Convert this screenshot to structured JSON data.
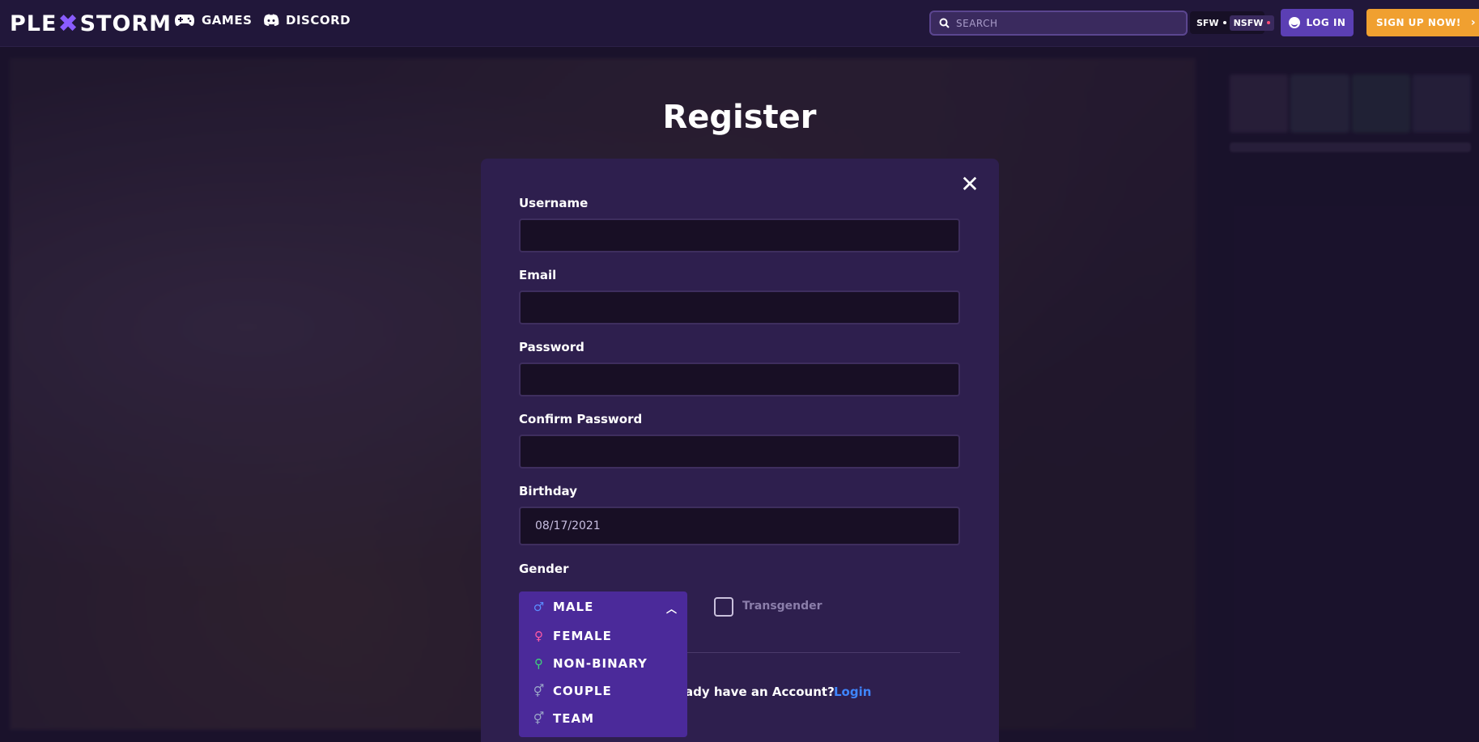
{
  "brand": {
    "logo_left": "PLE",
    "logo_x": "✖",
    "logo_right": "STORM"
  },
  "nav": {
    "games_label": "GAMES",
    "discord_label": "DISCORD"
  },
  "search": {
    "placeholder": "SEARCH"
  },
  "content_filter": {
    "sfw_label": "SFW",
    "nsfw_label": "NSFW"
  },
  "auth": {
    "login_label": "LOG IN",
    "signup_label": "SIGN UP NOW!"
  },
  "register": {
    "heading": "Register",
    "close_glyph": "✕",
    "fields": {
      "username_label": "Username",
      "username_value": "",
      "email_label": "Email",
      "email_value": "",
      "password_label": "Password",
      "password_value": "",
      "confirm_label": "Confirm Password",
      "confirm_value": "",
      "birthday_label": "Birthday",
      "birthday_value": "08/17/2021"
    },
    "gender": {
      "label": "Gender",
      "selected": "MALE",
      "options": [
        {
          "label": "MALE",
          "icon": "male-icon",
          "glyph": "♂",
          "color": "#5b8cff"
        },
        {
          "label": "FEMALE",
          "icon": "female-icon",
          "glyph": "♀",
          "color": "#ff5aa5"
        },
        {
          "label": "NON-BINARY",
          "icon": "nonbinary-icon",
          "glyph": "⚲",
          "color": "#3fd27a"
        },
        {
          "label": "COUPLE",
          "icon": "couple-icon",
          "glyph": "⚥",
          "color": "#9aa6c8"
        },
        {
          "label": "TEAM",
          "icon": "team-icon",
          "glyph": "⚥",
          "color": "#9aa6c8"
        }
      ],
      "transgender_label": "Transgender",
      "transgender_checked": false
    },
    "footer": {
      "account_prompt": "ady have an Account?",
      "login_link": "Login"
    }
  },
  "colors": {
    "accent": "#5b3fb4",
    "signup": "#f0a030",
    "link": "#3f86ff",
    "modal_bg": "#2e1f4e"
  }
}
